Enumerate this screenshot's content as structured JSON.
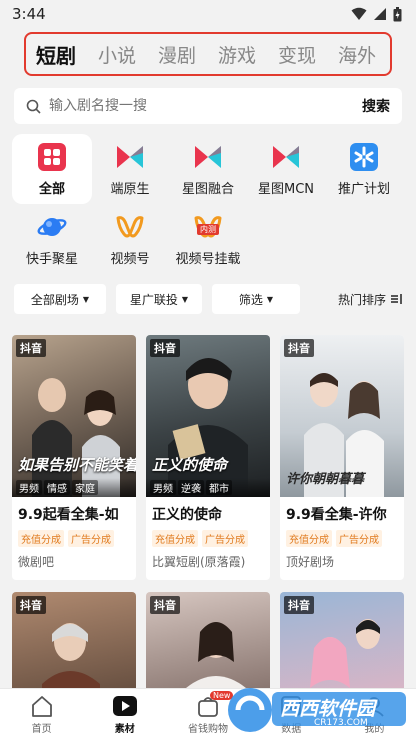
{
  "status_bar": {
    "time": "3:44"
  },
  "category_tabs": [
    {
      "label": "短剧",
      "active": true
    },
    {
      "label": "小说",
      "active": false
    },
    {
      "label": "漫剧",
      "active": false
    },
    {
      "label": "游戏",
      "active": false
    },
    {
      "label": "变现",
      "active": false
    },
    {
      "label": "海外",
      "active": false
    }
  ],
  "search": {
    "placeholder": "输入剧名搜一搜",
    "button": "搜索"
  },
  "channels": [
    {
      "label": "全部",
      "icon": "grid-icon",
      "active": true
    },
    {
      "label": "端原生",
      "icon": "bowtie-icon",
      "active": false
    },
    {
      "label": "星图融合",
      "icon": "bowtie-icon",
      "active": false
    },
    {
      "label": "星图MCN",
      "icon": "bowtie-icon",
      "active": false
    },
    {
      "label": "推广计划",
      "icon": "sparkle-icon",
      "active": false
    },
    {
      "label": "快手聚星",
      "icon": "planet-icon",
      "active": false
    },
    {
      "label": "视频号",
      "icon": "butterfly-icon",
      "active": false
    },
    {
      "label": "视频号挂载",
      "icon": "butterfly-icon",
      "badge": "内测",
      "active": false
    }
  ],
  "filters": {
    "all_dramas": "全部剧场",
    "star_link": "星广联投",
    "screen": "筛选",
    "sort": "热门排序"
  },
  "cards": [
    {
      "platform": "抖音",
      "poster_title": "如果告别不能笑着说",
      "tags": [
        "男频",
        "情感",
        "家庭"
      ],
      "title": "9.9起看全集-如",
      "chips": [
        "充值分成",
        "广告分成"
      ],
      "source": "微剧吧",
      "colors": [
        "#8a7a6a",
        "#3b3631"
      ]
    },
    {
      "platform": "抖音",
      "poster_title": "正义的使命",
      "tags": [
        "男频",
        "逆袭",
        "都市"
      ],
      "title": "正义的使命",
      "chips": [
        "充值分成",
        "广告分成"
      ],
      "source": "比翼短剧(原落霞)",
      "colors": [
        "#5d6a6e",
        "#232629"
      ]
    },
    {
      "platform": "抖音",
      "poster_title": "许你朝朝暮暮",
      "tags": [],
      "title": "9.9看全集-许你",
      "chips": [
        "充值分成",
        "广告分成"
      ],
      "source": "顶好剧场",
      "colors": [
        "#dfe2e6",
        "#a9b0b6"
      ]
    }
  ],
  "cards_row2": [
    {
      "platform": "抖音",
      "colors": [
        "#9a6d54",
        "#4e3b31"
      ]
    },
    {
      "platform": "抖音",
      "colors": [
        "#c9b7b0",
        "#6d5a55"
      ]
    },
    {
      "platform": "抖音",
      "colors": [
        "#8aa6c6",
        "#d9a5b5"
      ]
    }
  ],
  "bottom_nav": [
    {
      "label": "首页",
      "icon": "home-icon",
      "active": false
    },
    {
      "label": "素材",
      "icon": "play-icon",
      "active": true
    },
    {
      "label": "省钱购物",
      "icon": "bag-icon",
      "badge": "New",
      "active": false
    },
    {
      "label": "数据",
      "icon": "chart-icon",
      "active": false
    },
    {
      "label": "我的",
      "icon": "user-icon",
      "active": false
    }
  ],
  "watermark": {
    "brand": "西西软件园",
    "url": "CR173.COM"
  },
  "accent": "#e23a2e"
}
